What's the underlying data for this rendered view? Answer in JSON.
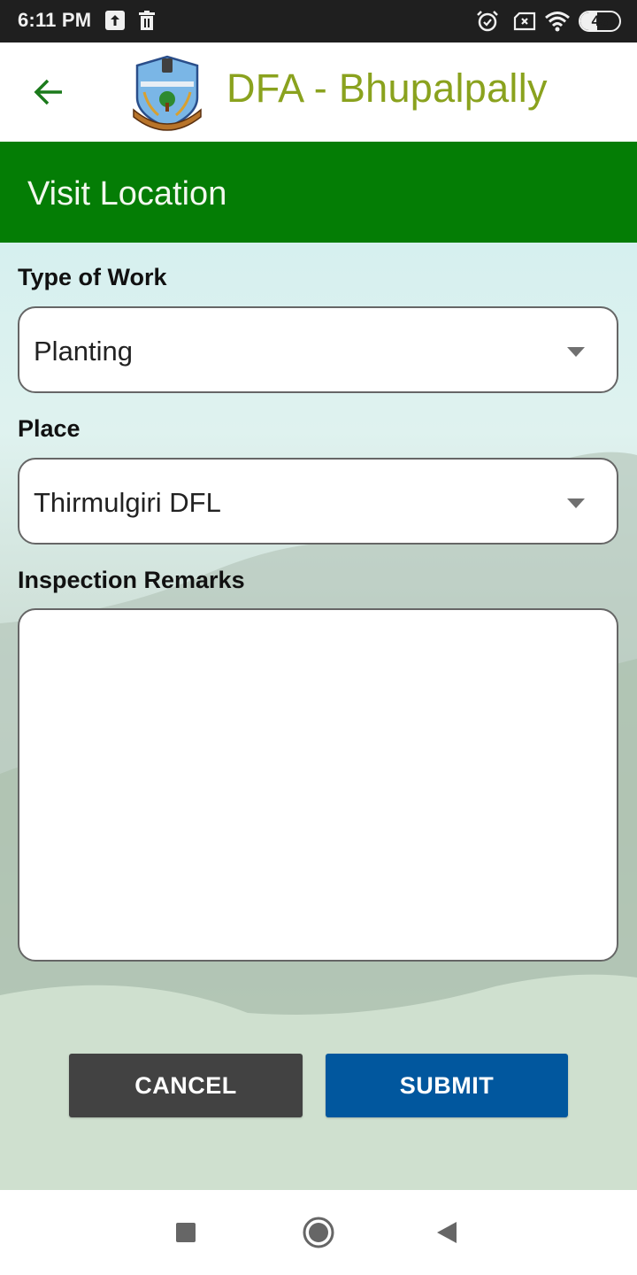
{
  "status_bar": {
    "time": "6:11 PM",
    "battery_level": "43",
    "battery_fraction": 0.43,
    "icons": [
      "upload-icon",
      "trash-icon",
      "alarm-icon",
      "no-sim-icon",
      "wifi-icon",
      "battery-icon"
    ]
  },
  "header": {
    "back_icon": "arrow-left-icon",
    "logo": "telangana-state-forest-emblem",
    "title": "DFA - Bhupalpally",
    "title_color": "#8aa21e"
  },
  "section": {
    "title": "Visit Location",
    "bar_color": "#047d05"
  },
  "form": {
    "type_of_work": {
      "label": "Type of Work",
      "value": "Planting"
    },
    "place": {
      "label": "Place",
      "value": "Thirmulgiri DFL"
    },
    "remarks": {
      "label": "Inspection Remarks",
      "value": ""
    }
  },
  "actions": {
    "cancel_label": "CANCEL",
    "submit_label": "SUBMIT",
    "cancel_color": "#424242",
    "submit_color": "#01579e"
  },
  "nav_bar": {
    "items": [
      "recents-icon",
      "home-icon",
      "back-icon"
    ]
  }
}
